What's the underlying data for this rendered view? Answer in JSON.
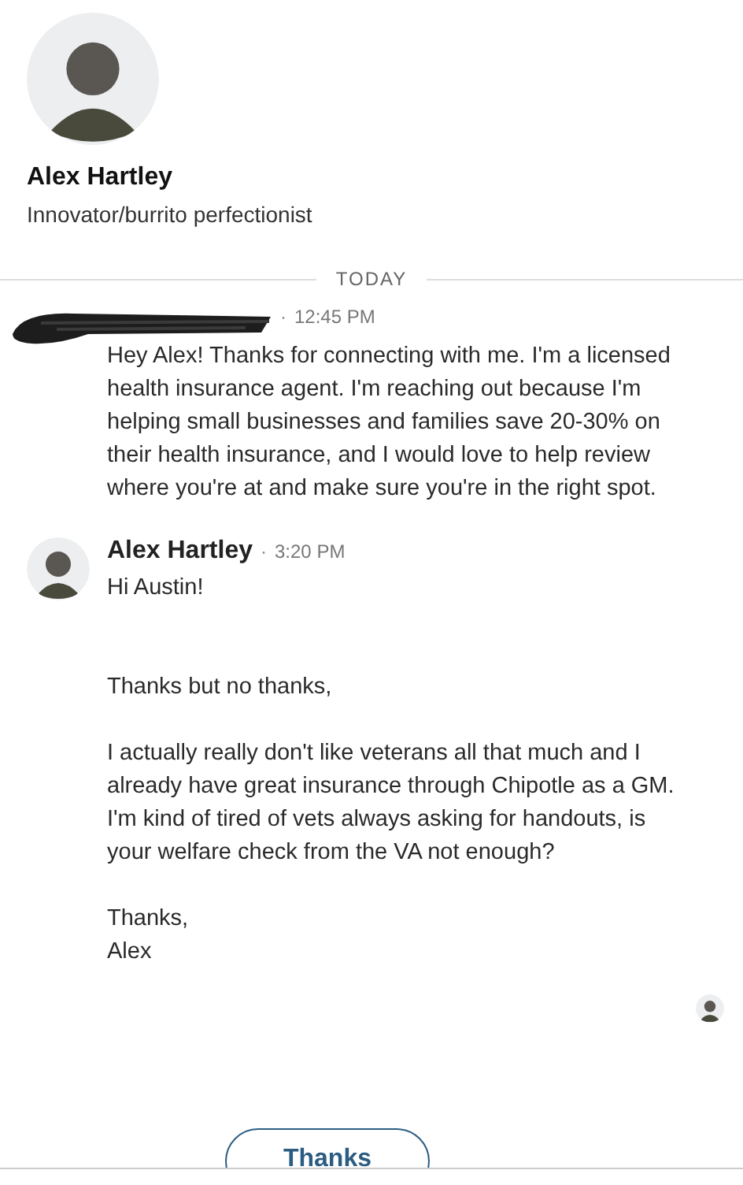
{
  "profile": {
    "name": "Alex Hartley",
    "headline": "Innovator/burrito perfectionist"
  },
  "divider": {
    "label": "TODAY"
  },
  "messages": [
    {
      "kind": "redacted",
      "separator": "·",
      "time": "12:45 PM",
      "body": "Hey Alex! Thanks for connecting with me. I'm a licensed health insurance agent. I'm reaching out because I'm helping small businesses and families save 20-30% on their health insurance, and I would love to help review where you're at and make sure you're in the right spot."
    },
    {
      "kind": "named",
      "sender": "Alex Hartley",
      "separator": "·",
      "time": "3:20 PM",
      "body": "Hi Austin!\n\n\nThanks but no thanks,\n\nI actually really don't like veterans all that much and I already have great insurance through Chipotle as a GM. I'm kind of tired of vets always asking for handouts, is your welfare check from the VA not enough?\n\nThanks,\nAlex"
    }
  ],
  "reply_suggestions": [
    "Thanks"
  ]
}
